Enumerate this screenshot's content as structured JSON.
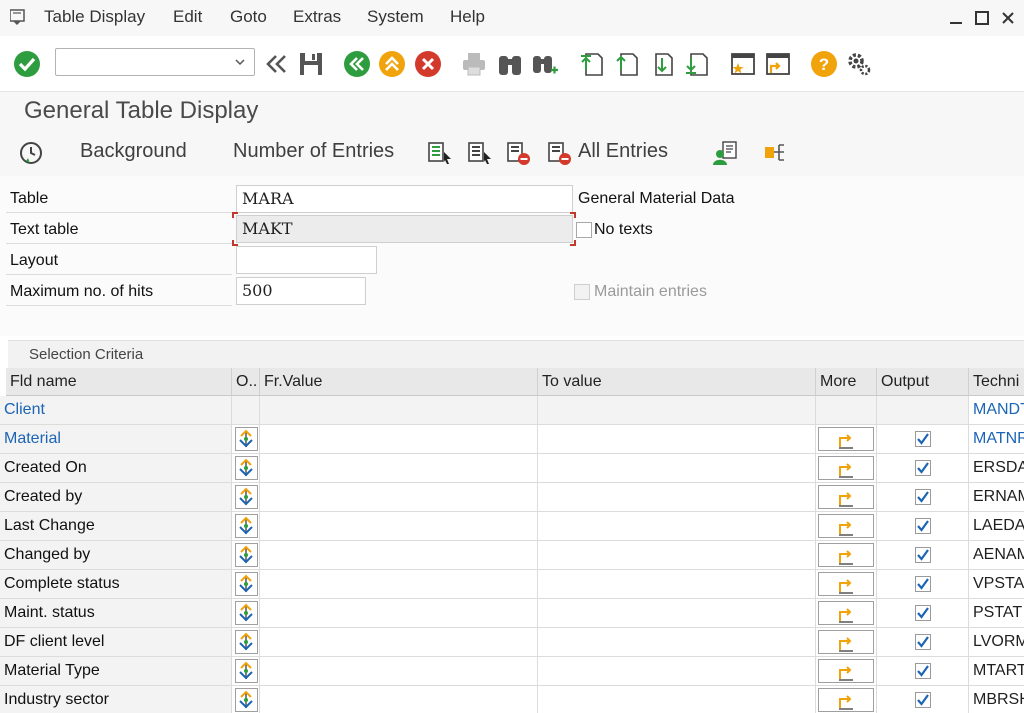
{
  "menu": {
    "items": [
      "Table Display",
      "Edit",
      "Goto",
      "Extras",
      "System",
      "Help"
    ]
  },
  "toolbar": {
    "command_field_value": ""
  },
  "page": {
    "title": "General Table Display"
  },
  "app_toolbar": {
    "background": "Background",
    "number_of_entries": "Number of Entries",
    "all_entries": "All Entries"
  },
  "form": {
    "table_label": "Table",
    "table_value": "MARA",
    "table_desc": "General Material Data",
    "text_table_label": "Text table",
    "text_table_value": "MAKT",
    "no_texts_label": "No texts",
    "layout_label": "Layout",
    "layout_value": "",
    "max_hits_label": "Maximum no. of hits",
    "max_hits_value": "500",
    "maintain_entries_label": "Maintain entries"
  },
  "selection": {
    "title": "Selection Criteria",
    "columns": {
      "fld_name": "Fld name",
      "op": "O..",
      "from": "Fr.Value",
      "to": "To value",
      "more": "More",
      "output": "Output",
      "technical": "Techni"
    },
    "rows": [
      {
        "name": "Client",
        "tech": "MANDT",
        "key": true,
        "has_controls": false
      },
      {
        "name": "Material",
        "tech": "MATNR",
        "key": true,
        "has_controls": true
      },
      {
        "name": "Created On",
        "tech": "ERSDA",
        "key": false,
        "has_controls": true
      },
      {
        "name": "Created by",
        "tech": "ERNAM",
        "key": false,
        "has_controls": true
      },
      {
        "name": "Last Change",
        "tech": "LAEDA",
        "key": false,
        "has_controls": true
      },
      {
        "name": "Changed by",
        "tech": "AENAM",
        "key": false,
        "has_controls": true
      },
      {
        "name": "Complete status",
        "tech": "VPSTA",
        "key": false,
        "has_controls": true
      },
      {
        "name": "Maint. status",
        "tech": "PSTAT",
        "key": false,
        "has_controls": true
      },
      {
        "name": "DF client level",
        "tech": "LVORM",
        "key": false,
        "has_controls": true
      },
      {
        "name": "Material Type",
        "tech": "MTART",
        "key": false,
        "has_controls": true
      },
      {
        "name": "Industry sector",
        "tech": "MBRSH",
        "key": false,
        "has_controls": true
      }
    ]
  },
  "colors": {
    "key_blue": "#1c64b4",
    "green": "#2e9d3f",
    "orange": "#f0a30a",
    "red": "#d33a2c"
  }
}
